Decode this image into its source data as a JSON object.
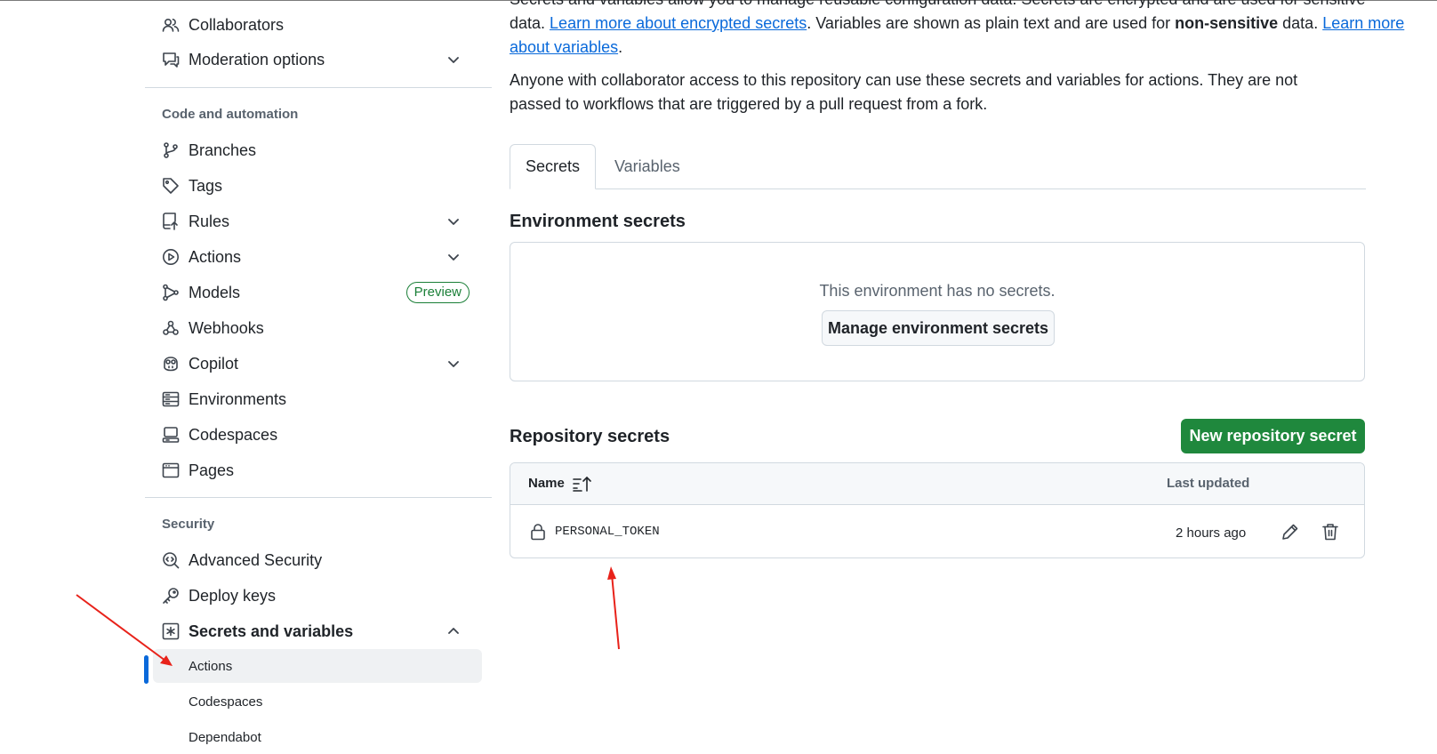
{
  "sidebar": {
    "top_items": [
      {
        "label": "Collaborators",
        "icon": "people-icon"
      },
      {
        "label": "Moderation options",
        "icon": "report-icon"
      }
    ],
    "code_automation_heading": "Code and automation",
    "code_items": [
      {
        "label": "Branches",
        "icon": "git-branch-icon"
      },
      {
        "label": "Tags",
        "icon": "tag-icon"
      },
      {
        "label": "Rules",
        "icon": "repo-push-icon"
      },
      {
        "label": "Actions",
        "icon": "play-icon"
      },
      {
        "label": "Models",
        "icon": "models-icon",
        "badge": "Preview"
      },
      {
        "label": "Webhooks",
        "icon": "webhook-icon"
      },
      {
        "label": "Copilot",
        "icon": "copilot-icon"
      },
      {
        "label": "Environments",
        "icon": "server-icon"
      },
      {
        "label": "Codespaces",
        "icon": "codespaces-icon"
      },
      {
        "label": "Pages",
        "icon": "browser-icon"
      }
    ],
    "security_heading": "Security",
    "security_items": [
      {
        "label": "Advanced Security",
        "icon": "codescan-icon"
      },
      {
        "label": "Deploy keys",
        "icon": "key-icon"
      },
      {
        "label": "Secrets and variables",
        "icon": "asterisk-icon"
      }
    ],
    "secrets_sub_items": [
      {
        "label": "Actions",
        "active": true
      },
      {
        "label": "Codespaces"
      },
      {
        "label": "Dependabot"
      }
    ]
  },
  "main": {
    "desc_line0": "Secrets and variables allow you to manage reusable configuration data. Secrets are encrypted and are used for sensitive",
    "desc_line1_a": "data. ",
    "desc_link1": "Learn more about encrypted secrets",
    "desc_line1_b": ". Variables are shown as plain text and are used for ",
    "desc_line1_bold": "non-sensitive",
    "desc_line1_c": " data. ",
    "desc_link2_a": "Learn more",
    "desc_link2_b": "about variables",
    "desc_line2_end": ".",
    "desc_para2": "Anyone with collaborator access to this repository can use these secrets and variables for actions. They are not passed to workflows that are triggered by a pull request from a fork.",
    "tabs": [
      {
        "label": "Secrets",
        "active": true
      },
      {
        "label": "Variables"
      }
    ],
    "env_heading": "Environment secrets",
    "env_empty": "This environment has no secrets.",
    "env_button": "Manage environment secrets",
    "repo_heading": "Repository secrets",
    "new_button": "New repository secret",
    "table": {
      "col_name": "Name",
      "col_updated": "Last updated",
      "rows": [
        {
          "name": "PERSONAL_TOKEN",
          "updated": "2 hours ago"
        }
      ]
    }
  },
  "colors": {
    "accent": "#0969da",
    "primary_button": "#1f883d",
    "badge": "#1a7f37",
    "annotation_arrow": "#e8221a"
  }
}
